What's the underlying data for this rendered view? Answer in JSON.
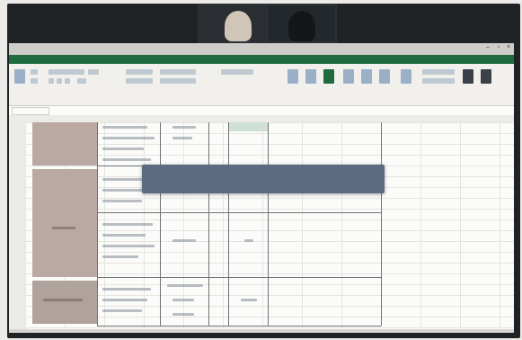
{
  "window": {
    "title": ""
  },
  "ribbon": {
    "tabs": [
      "",
      "",
      "",
      "",
      "",
      "",
      "",
      ""
    ]
  },
  "toast": {
    "message": ""
  },
  "video_call": {
    "participants": [
      "",
      ""
    ]
  },
  "colors": {
    "ribbon_green": "#1f6b3d",
    "toast_bg": "#5b6b80",
    "merged_cell": "#b9a9a2"
  }
}
